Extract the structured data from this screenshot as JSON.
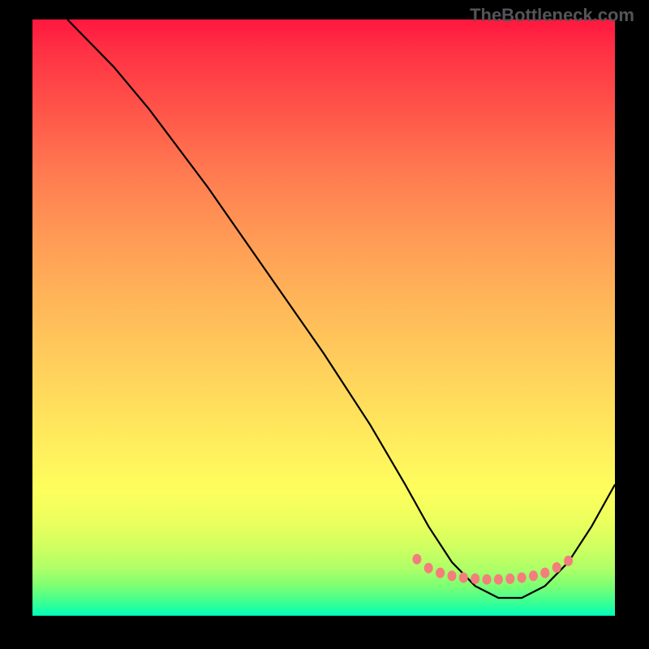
{
  "attribution": "TheBottleneck.com",
  "chart_data": {
    "type": "line",
    "title": "",
    "xlabel": "",
    "ylabel": "",
    "xlim": [
      0,
      100
    ],
    "ylim": [
      0,
      100
    ],
    "series": [
      {
        "name": "bottleneck-curve",
        "x": [
          6,
          8,
          10,
          14,
          20,
          30,
          40,
          50,
          58,
          64,
          68,
          72,
          76,
          80,
          84,
          88,
          92,
          96,
          100
        ],
        "y": [
          100,
          98,
          96,
          92,
          85,
          72,
          58,
          44,
          32,
          22,
          15,
          9,
          5,
          3,
          3,
          5,
          9,
          15,
          22
        ]
      }
    ],
    "markers": {
      "name": "highlighted-points",
      "points": [
        {
          "x": 66,
          "y": 9.5
        },
        {
          "x": 68,
          "y": 8
        },
        {
          "x": 70,
          "y": 7.2
        },
        {
          "x": 72,
          "y": 6.7
        },
        {
          "x": 74,
          "y": 6.4
        },
        {
          "x": 76,
          "y": 6.2
        },
        {
          "x": 78,
          "y": 6.1
        },
        {
          "x": 80,
          "y": 6.1
        },
        {
          "x": 82,
          "y": 6.2
        },
        {
          "x": 84,
          "y": 6.4
        },
        {
          "x": 86,
          "y": 6.7
        },
        {
          "x": 88,
          "y": 7.2
        },
        {
          "x": 90,
          "y": 8.1
        },
        {
          "x": 92,
          "y": 9.2
        }
      ]
    }
  }
}
